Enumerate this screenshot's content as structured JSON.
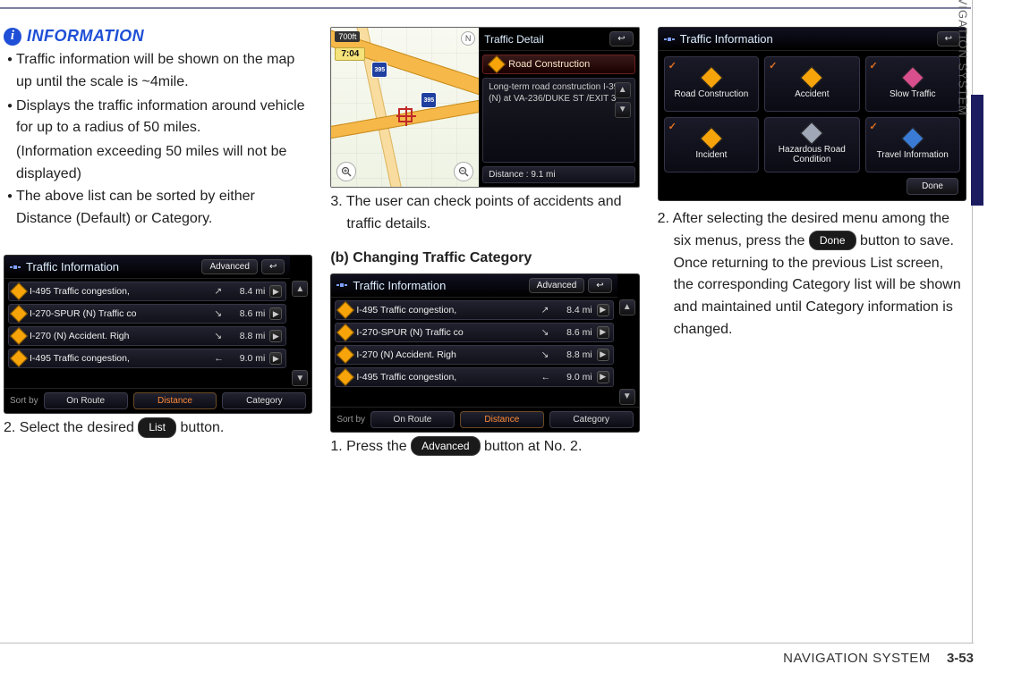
{
  "information": {
    "heading": "INFORMATION",
    "bullets": [
      "Traffic information will be shown on the map up until the scale is ~4mile.",
      "Displays the traffic information around vehicle for up to a radius of 50 miles."
    ],
    "note": "(Information exceeding 50 miles will not be displayed)",
    "bullet3": "The above list can be sorted by either Distance (Default) or Category."
  },
  "col1": {
    "step2_pre": "2. Select the desired ",
    "step2_btn": "List",
    "step2_post": " button."
  },
  "col2": {
    "step3": "3. The user can check points of accidents and traffic details.",
    "subheading": "(b) Changing Traffic Category",
    "step1_pre": "1. Press the ",
    "step1_btn": "Advanced",
    "step1_post": " button at No. 2."
  },
  "col3": {
    "step2_pre": "2. After selecting the desired menu among the six menus, press the ",
    "step2_btn": "Done",
    "step2_post": " button to save. Once returning to the previous List screen, the corresponding Category list will be shown and maintained until Category information is changed."
  },
  "traffic_list_screen": {
    "title": "Traffic Information",
    "advanced": "Advanced",
    "back_icon": "↩",
    "rows": [
      {
        "name": "I-495 Traffic congestion,",
        "dir": "↗",
        "dist": "8.4 mi"
      },
      {
        "name": "I-270-SPUR (N) Traffic co",
        "dir": "↘",
        "dist": "8.6 mi"
      },
      {
        "name": "I-270 (N) Accident. Righ",
        "dir": "↘",
        "dist": "8.8 mi"
      },
      {
        "name": "I-495 Traffic congestion,",
        "dir": "←",
        "dist": "9.0 mi"
      }
    ],
    "sort_label": "Sort by",
    "sort_options": [
      "On Route",
      "Distance",
      "Category"
    ],
    "scroll_up": "▲",
    "scroll_down": "▼",
    "play": "▶"
  },
  "map_detail_screen": {
    "scale": "700ft",
    "time": "7:04",
    "compass": "N",
    "shields": [
      "395",
      "395"
    ],
    "zoom_in": "+",
    "zoom_out": "−",
    "detail_title": "Traffic Detail",
    "detail_back": "↩",
    "category": "Road Construction",
    "desc": "Long-term road construction I-395 (N)  at VA-236/DUKE ST /EXIT 3",
    "distance": "Distance : 9.1 mi",
    "scroll_up": "▲",
    "scroll_down": "▼"
  },
  "category_screen": {
    "title": "Traffic Information",
    "back_icon": "↩",
    "cells": [
      {
        "label": "Road Construction",
        "color": "#f7a40a",
        "checked": true
      },
      {
        "label": "Accident",
        "color": "#f7a40a",
        "checked": true
      },
      {
        "label": "Slow Traffic",
        "color": "#d94f8e",
        "checked": true
      },
      {
        "label": "Incident",
        "color": "#f7a40a",
        "checked": true
      },
      {
        "label": "Hazardous Road Condition",
        "color": "#a0a8b8",
        "checked": false
      },
      {
        "label": "Travel Information",
        "color": "#3a7bd5",
        "checked": true
      }
    ],
    "done": "Done"
  },
  "side": {
    "label": "NAVIGATION SYSTEM"
  },
  "footer": {
    "section": "NAVIGATION SYSTEM",
    "page": "3-53"
  }
}
